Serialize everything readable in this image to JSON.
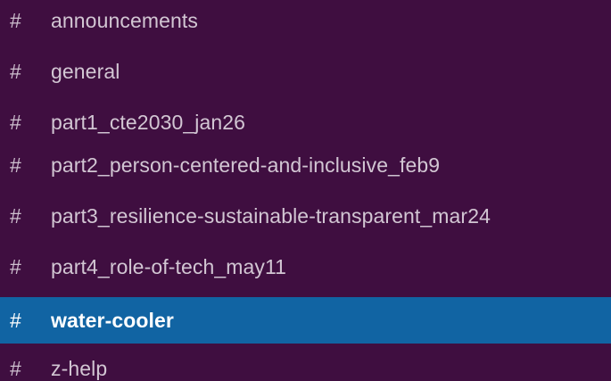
{
  "sidebar": {
    "channel_prefix": "#",
    "active_channel": "water-cooler",
    "channels": [
      {
        "name": "announcements"
      },
      {
        "name": "general"
      },
      {
        "name": "part1_cte2030_jan26"
      },
      {
        "name": "part2_person-centered-and-inclusive_feb9"
      },
      {
        "name": "part3_resilience-sustainable-transparent_mar24"
      },
      {
        "name": "part4_role-of-tech_may11"
      },
      {
        "name": "water-cooler"
      },
      {
        "name": "z-help"
      }
    ]
  },
  "colors": {
    "sidebar_background": "#3f0e40",
    "active_background": "#1164a3",
    "text": "#d2c6d3",
    "active_text": "#ffffff"
  }
}
